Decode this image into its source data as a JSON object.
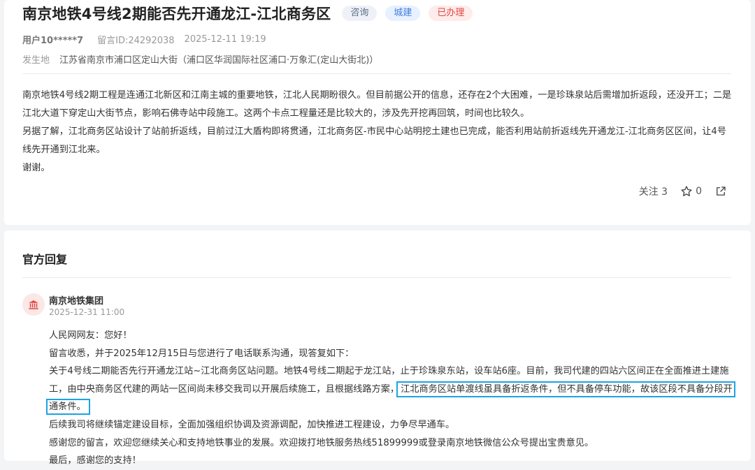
{
  "question": {
    "title": "南京地铁4号线2期能否先开通龙江-江北商务区",
    "tags": [
      "咨询",
      "城建",
      "已办理"
    ],
    "user": "用户10*****7",
    "message_id": "留言ID:24292038",
    "datetime": "2025-12-11 19:19",
    "location_label": "发生地",
    "location_value": "江苏省南京市浦口区定山大街（浦口区华润国际社区浦口·万象汇(定山大街北)）",
    "paragraphs": [
      "南京地铁4号线2期工程是连通江北新区和江南主城的重要地铁，江北人民期盼很久。但目前据公开的信息，还存在2个大困难，一是珍珠泉站后需增加折返段，还没开工；二是江北大道下穿定山大街节点，影响石佛寺站中段施工。这两个卡点工程量还是比较大的，涉及先开挖再回筑，时间也比较久。",
      "另据了解，江北商务区站设计了站前折返线，目前过江大盾构即将贯通，江北商务区-市民中心站明挖土建也已完成，能否利用站前折返线先开通龙江-江北商务区区间，让4号线先开通到江北来。",
      "谢谢。"
    ],
    "follow_label": "关注 3",
    "star_count": "0"
  },
  "reply": {
    "heading": "官方回复",
    "org_name": "南京地铁集团",
    "org_date": "2025-12-31 11:00",
    "greeting": "人民网网友：您好！",
    "p1": "留言收悉，并于2025年12月15日与您进行了电话联系沟通，现答复如下：",
    "p2_a": "关于4号线二期能否先行开通龙江站~江北商务区站问题。地铁4号线二期起于龙江站，止于珍珠泉东站，设车站6座。目前，我司代建的四站六区间正在全面推进土建施工，由中央商务区代建的两站一区间尚未移交我司以开展后续施工，且根据线路方案，",
    "p2_highlight": "江北商务区站单渡线虽具备折返条件，但不具备停车功能，故该区段不具备分段开通条件。",
    "p3": "后续我司将继续锚定建设目标，全面加强组织协调及资源调配，加快推进工程建设，力争尽早通车。",
    "p4": "感谢您的留言，欢迎您继续关心和支持地铁事业的发展。欢迎拨打地铁服务热线51899999或登录南京地铁微信公众号提出宝贵意见。",
    "p5": "最后，感谢您的支持！"
  },
  "colors": {
    "tag_done": "#e2463f",
    "tag_city": "#3f7fe0",
    "highlight_box": "#1aa3e8"
  }
}
